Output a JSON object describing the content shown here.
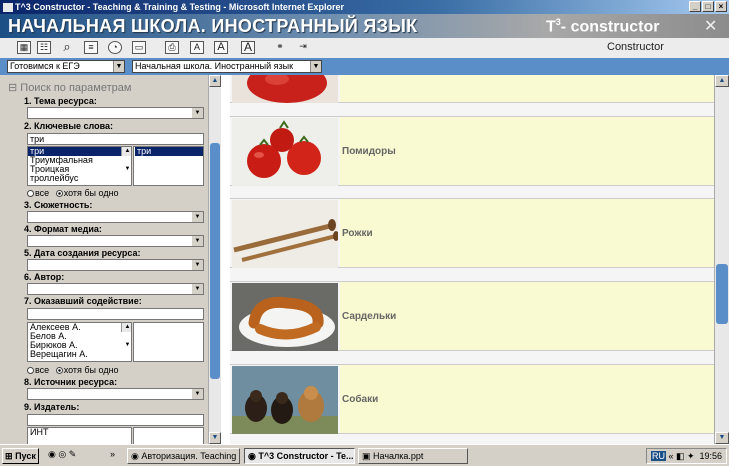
{
  "window": {
    "title": "T^3 Constructor - Teaching & Training & Testing - Microsoft Internet Explorer"
  },
  "banner": {
    "heading": "НАЧАЛЬНАЯ ШКОЛА. ИНОСТРАННЫЙ ЯЗЫК",
    "logo_prefix": "T",
    "logo_sup": "3",
    "logo_suffix": "- constructor"
  },
  "toolbar": {
    "icons": [
      "grid-icon",
      "tree-icon",
      "search-icon",
      "list-icon",
      "clock-icon",
      "card-icon",
      "print-icon",
      "font-small-icon",
      "font-medium-icon",
      "font-large-icon",
      "users-icon",
      "exit-icon"
    ],
    "font_labels": [
      "A",
      "A",
      "A"
    ],
    "constructor_label": "Constructor"
  },
  "selects": {
    "first": "Готовимся к ЕГЭ",
    "second": "Начальная школа. Иностранный язык"
  },
  "filter": {
    "search_title": "Поиск по параметрам",
    "topic_label": "1. Тема ресурса:",
    "keywords_label": "2. Ключевые слова:",
    "keyword_value": "три",
    "keyword_suggestions": [
      "три",
      "Триумфальная",
      "Троицкая",
      "троллейбус"
    ],
    "keyword_selected": [
      "три"
    ],
    "radio_all": "все",
    "radio_any": "хотя бы одно",
    "plot_label": "3. Сюжетность:",
    "media_label": "4. Формат медиа:",
    "date_label": "5. Дата создания ресурса:",
    "author_label": "6. Автор:",
    "helper_label": "7. Оказавший содействие:",
    "helpers": [
      "Алексеев А.",
      "Белов А.",
      "Бирюков А.",
      "Верещагин А."
    ],
    "source_label": "8. Источник ресурса:",
    "publisher_label": "9. Издатель:",
    "publisher_value": "ИНТ"
  },
  "results": [
    {
      "title": "",
      "image": "tomato-image"
    },
    {
      "title": "Помидоры",
      "image": "tomatoes-image"
    },
    {
      "title": "Рожки",
      "image": "horns-image"
    },
    {
      "title": "Сардельки",
      "image": "sausages-image"
    },
    {
      "title": "Собаки",
      "image": "dogs-image"
    }
  ],
  "taskbar": {
    "start": "Пуск",
    "chevron": "»",
    "tasks": [
      "Авторизация. Teaching ...",
      "T^3 Constructor - Te...",
      "Началка.ppt"
    ],
    "lang": "RU",
    "time": "19:56"
  },
  "colors": {
    "banner": "#1c4f86",
    "selbar": "#5a8ec8",
    "result_bg": "#fafad2",
    "highlight": "#0a246a"
  }
}
